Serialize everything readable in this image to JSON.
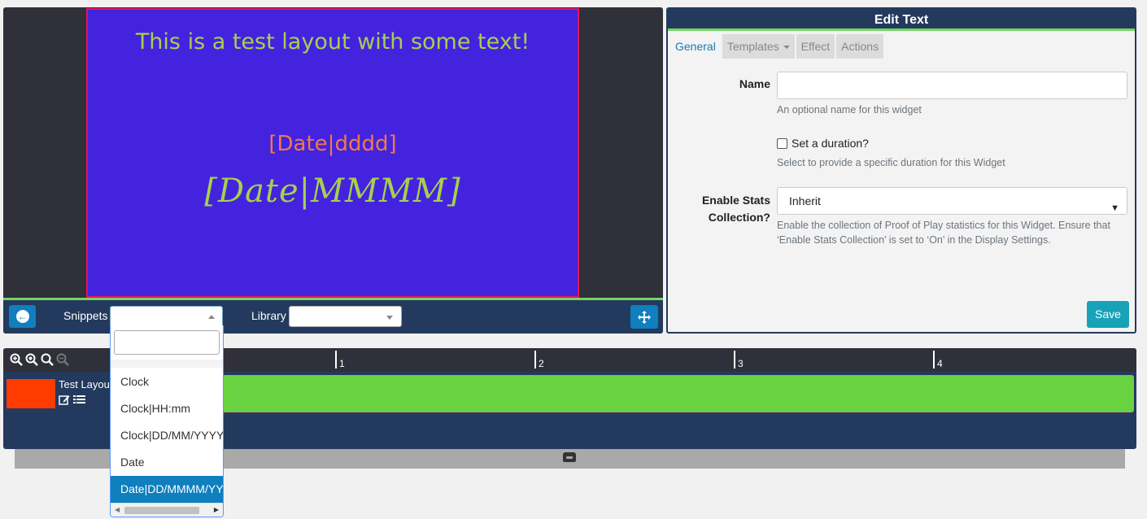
{
  "canvas": {
    "title_text": "This is a test layout with some text!",
    "day_text": "[Date|dddd]",
    "month_text": "[Date|MMMM]",
    "background_color": "#4423de",
    "border_color": "#e2155a"
  },
  "viewer_toolbar": {
    "snippets_label": "Snippets",
    "library_label": "Library",
    "back_icon": "arrow-left-circle-icon",
    "move_icon": "arrows-move-icon"
  },
  "edit_panel": {
    "title": "Edit Text",
    "tabs": [
      {
        "label": "General",
        "active": true
      },
      {
        "label": "Templates",
        "active": false
      },
      {
        "label": "Effect",
        "active": false
      },
      {
        "label": "Actions",
        "active": false
      }
    ],
    "name_label": "Name",
    "name_value": "",
    "name_help": "An optional name for this widget",
    "duration_label": "Set a duration?",
    "duration_checked": false,
    "duration_help": "Select to provide a specific duration for this Widget",
    "stats_label_line1": "Enable Stats",
    "stats_label_line2": "Collection?",
    "stats_value": "Inherit",
    "stats_help": "Enable the collection of Proof of Play statistics for this Widget. Ensure that ‘Enable Stats Collection’ is set to ‘On’ in the Display Settings.",
    "save_label": "Save"
  },
  "timeline": {
    "ticks": [
      "1",
      "2",
      "3",
      "4"
    ],
    "layout_name": "Test Layou",
    "layout_color": "#ff3b00",
    "bar_color": "#68d241"
  },
  "snippets_dropdown": {
    "search_value": "",
    "items": [
      {
        "label": "Clock",
        "selected": false
      },
      {
        "label": "Clock|HH:mm",
        "selected": false
      },
      {
        "label": "Clock|DD/MM/YYYY",
        "selected": false
      },
      {
        "label": "Date",
        "selected": false
      },
      {
        "label": "Date|DD/MMMM/YYYY",
        "selected": true
      }
    ]
  }
}
